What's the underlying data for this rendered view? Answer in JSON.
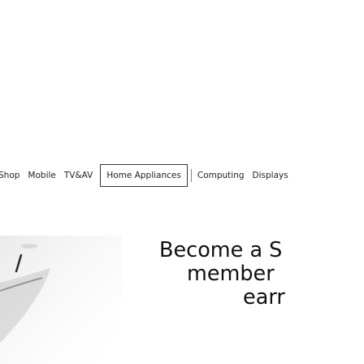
{
  "nav": {
    "items": [
      {
        "label": "Shop",
        "active": false
      },
      {
        "label": "Mobile",
        "active": false
      },
      {
        "label": "TV&AV",
        "active": false
      },
      {
        "label": "Home Appliances",
        "active": true
      },
      {
        "label": "Computing",
        "active": false
      },
      {
        "label": "Displays",
        "active": false
      }
    ]
  },
  "hero": {
    "title_lines": [
      "Become a S",
      "member",
      "earr"
    ]
  }
}
